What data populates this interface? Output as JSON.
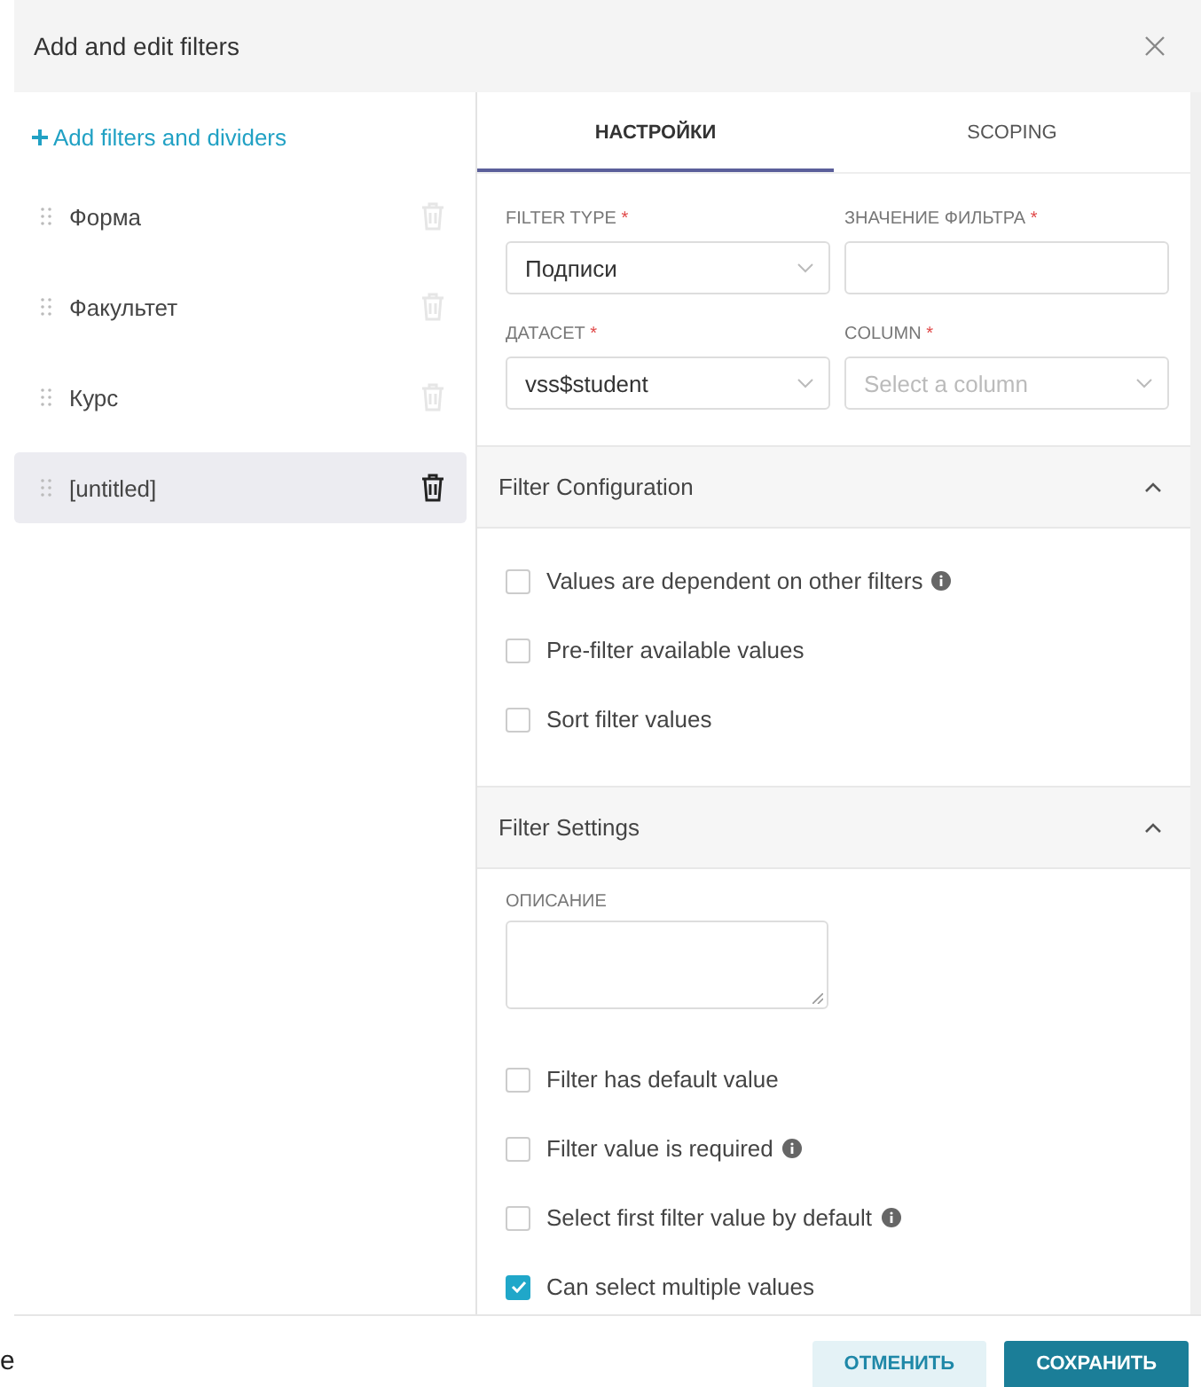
{
  "window": {
    "title": "Add and edit filters"
  },
  "sidebar": {
    "add_link": "Add filters and dividers",
    "items": [
      {
        "label": "Форма",
        "selected": false
      },
      {
        "label": "Факультет",
        "selected": false
      },
      {
        "label": "Курс",
        "selected": false
      },
      {
        "label": "[untitled]",
        "selected": true
      }
    ]
  },
  "tabs": [
    {
      "label": "НАСТРОЙКИ",
      "selected": true
    },
    {
      "label": "SCOPING",
      "selected": false
    }
  ],
  "fields": [
    {
      "label": "FILTER TYPE",
      "required_mark": "*",
      "kind": "select",
      "value": "Подписи"
    },
    {
      "label": "ЗНАЧЕНИЕ ФИЛЬТРА",
      "required_mark": "*",
      "kind": "text"
    },
    {
      "label": "ДАТАСЕТ",
      "required_mark": "*",
      "kind": "select",
      "value": "vss$student"
    },
    {
      "label": "COLUMN",
      "required_mark": "*",
      "kind": "select",
      "placeholder": "Select a column"
    }
  ],
  "sections": [
    {
      "title": "Filter Configuration",
      "expanded": true,
      "items": [
        {
          "kind": "checkbox",
          "label": "Values are dependent on other filters",
          "checked": false,
          "info": true
        },
        {
          "kind": "checkbox",
          "label": "Pre-filter available values",
          "checked": false,
          "info": false
        },
        {
          "kind": "checkbox",
          "label": "Sort filter values",
          "checked": false,
          "info": false
        }
      ]
    },
    {
      "title": "Filter Settings",
      "expanded": true,
      "items": [
        {
          "kind": "textarea",
          "label": "ОПИСАНИЕ"
        },
        {
          "kind": "checkbox",
          "label": "Filter has default value",
          "checked": false,
          "info": false
        },
        {
          "kind": "checkbox",
          "label": "Filter value is required",
          "checked": false,
          "info": true
        },
        {
          "kind": "checkbox",
          "label": "Select first filter value by default",
          "checked": false,
          "info": true
        },
        {
          "kind": "checkbox",
          "label": "Can select multiple values",
          "checked": true,
          "info": false
        }
      ]
    }
  ],
  "buttons": [
    {
      "label": "ОТМЕНИТЬ",
      "kind": "secondary"
    },
    {
      "label": "СОХРАНИТЬ",
      "kind": "primary"
    }
  ],
  "background_text": "e"
}
